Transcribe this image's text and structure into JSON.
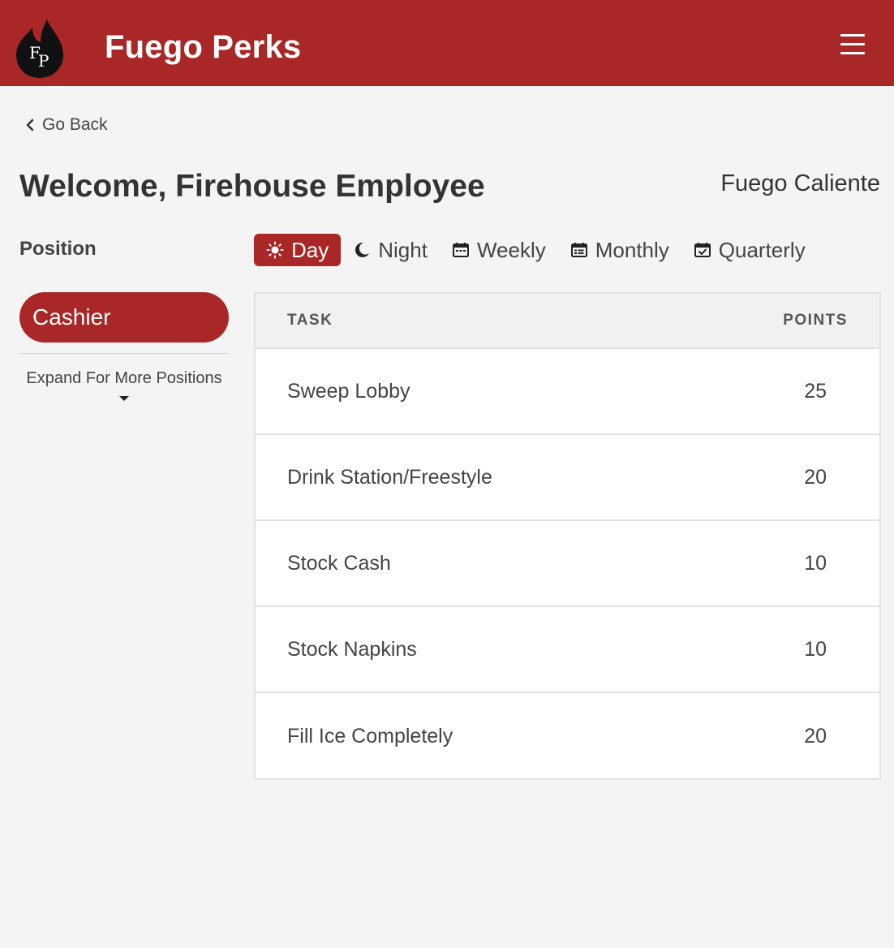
{
  "header": {
    "logo_text": "FP",
    "title": "Fuego Perks",
    "menu_icon": "hamburger-menu-icon"
  },
  "nav": {
    "back_label": "Go Back",
    "back_icon": "chevron-left-icon"
  },
  "page": {
    "welcome": "Welcome, Firehouse Employee",
    "store": "Fuego Caliente"
  },
  "sidebar": {
    "position_label": "Position",
    "selected_position": "Cashier",
    "expand_label": "Expand For More Positions"
  },
  "tabs": [
    {
      "label": "Day",
      "icon": "sun-icon",
      "active": true
    },
    {
      "label": "Night",
      "icon": "moon-icon",
      "active": false
    },
    {
      "label": "Weekly",
      "icon": "calendar-week-icon",
      "active": false
    },
    {
      "label": "Monthly",
      "icon": "calendar-month-icon",
      "active": false
    },
    {
      "label": "Quarterly",
      "icon": "calendar-check-icon",
      "active": false
    }
  ],
  "table": {
    "headers": {
      "task": "TASK",
      "points": "POINTS"
    },
    "rows": [
      {
        "task": "Sweep Lobby",
        "points": "25"
      },
      {
        "task": "Drink Station/Freestyle",
        "points": "20"
      },
      {
        "task": "Stock Cash",
        "points": "10"
      },
      {
        "task": "Stock Napkins",
        "points": "10"
      },
      {
        "task": "Fill Ice Completely",
        "points": "20"
      }
    ]
  },
  "colors": {
    "brand": "#a92726",
    "background": "#f4f4f4",
    "text": "#333333"
  }
}
